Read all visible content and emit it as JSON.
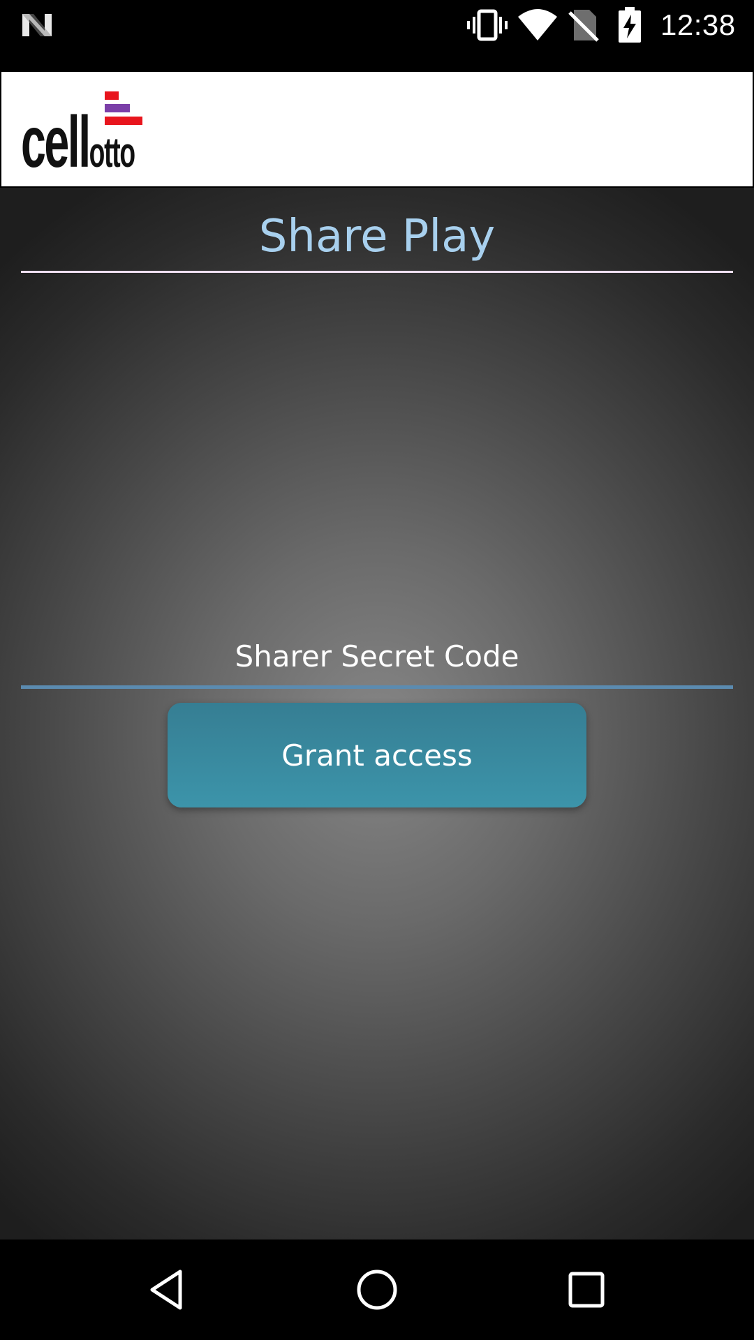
{
  "status_bar": {
    "time": "12:38",
    "icons": [
      "notification-n-icon",
      "vibrate-icon",
      "wifi-icon",
      "no-sim-icon",
      "battery-charging-icon"
    ]
  },
  "header": {
    "logo_text_main": "cell",
    "logo_text_sub": "otto",
    "logo_colors": [
      "#e8151d",
      "#7b3fa8",
      "#e8151d"
    ]
  },
  "main": {
    "title": "Share Play",
    "secret_code": {
      "placeholder": "Sharer Secret Code",
      "value": ""
    },
    "grant_button_label": "Grant access"
  },
  "nav_bar": {
    "buttons": [
      "back-icon",
      "home-icon",
      "recents-icon"
    ]
  },
  "colors": {
    "title": "#a8d0ee",
    "input_underline": "#5b8bb0",
    "button": "#3a8ca3"
  }
}
